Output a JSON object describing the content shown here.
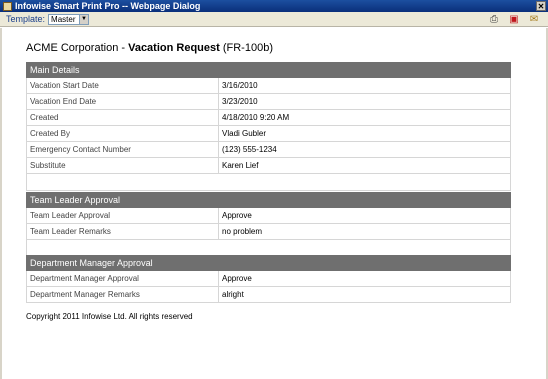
{
  "window": {
    "title": "Infowise Smart Print Pro -- Webpage Dialog",
    "close_glyph": "✕"
  },
  "toolbar": {
    "template_label": "Template:",
    "template_value": "Master",
    "icons": [
      "print-icon",
      "pdf-icon",
      "email-icon"
    ]
  },
  "document": {
    "company": "ACME Corporation - ",
    "form_name": "Vacation Request",
    "form_code": " (FR-100b)"
  },
  "sections": [
    {
      "title": "Main Details",
      "rows": [
        {
          "label": "Vacation Start Date",
          "value": "3/16/2010"
        },
        {
          "label": "Vacation End Date",
          "value": "3/23/2010"
        },
        {
          "label": "Created",
          "value": "4/18/2010 9:20 AM"
        },
        {
          "label": "Created By",
          "value": "Vladi Gubler"
        },
        {
          "label": "Emergency Contact Number",
          "value": "(123) 555-1234"
        },
        {
          "label": "Substitute",
          "value": "Karen Lief"
        }
      ]
    },
    {
      "title": "Team Leader Approval",
      "rows": [
        {
          "label": "Team Leader Approval",
          "value": "Approve"
        },
        {
          "label": "Team Leader Remarks",
          "value": "no problem"
        }
      ]
    },
    {
      "title": "Department Manager Approval",
      "rows": [
        {
          "label": "Department Manager Approval",
          "value": "Approve"
        },
        {
          "label": "Department Manager Remarks",
          "value": "alright"
        }
      ]
    }
  ],
  "footer": {
    "copyright": "Copyright 2011 Infowise Ltd. All rights reserved"
  }
}
